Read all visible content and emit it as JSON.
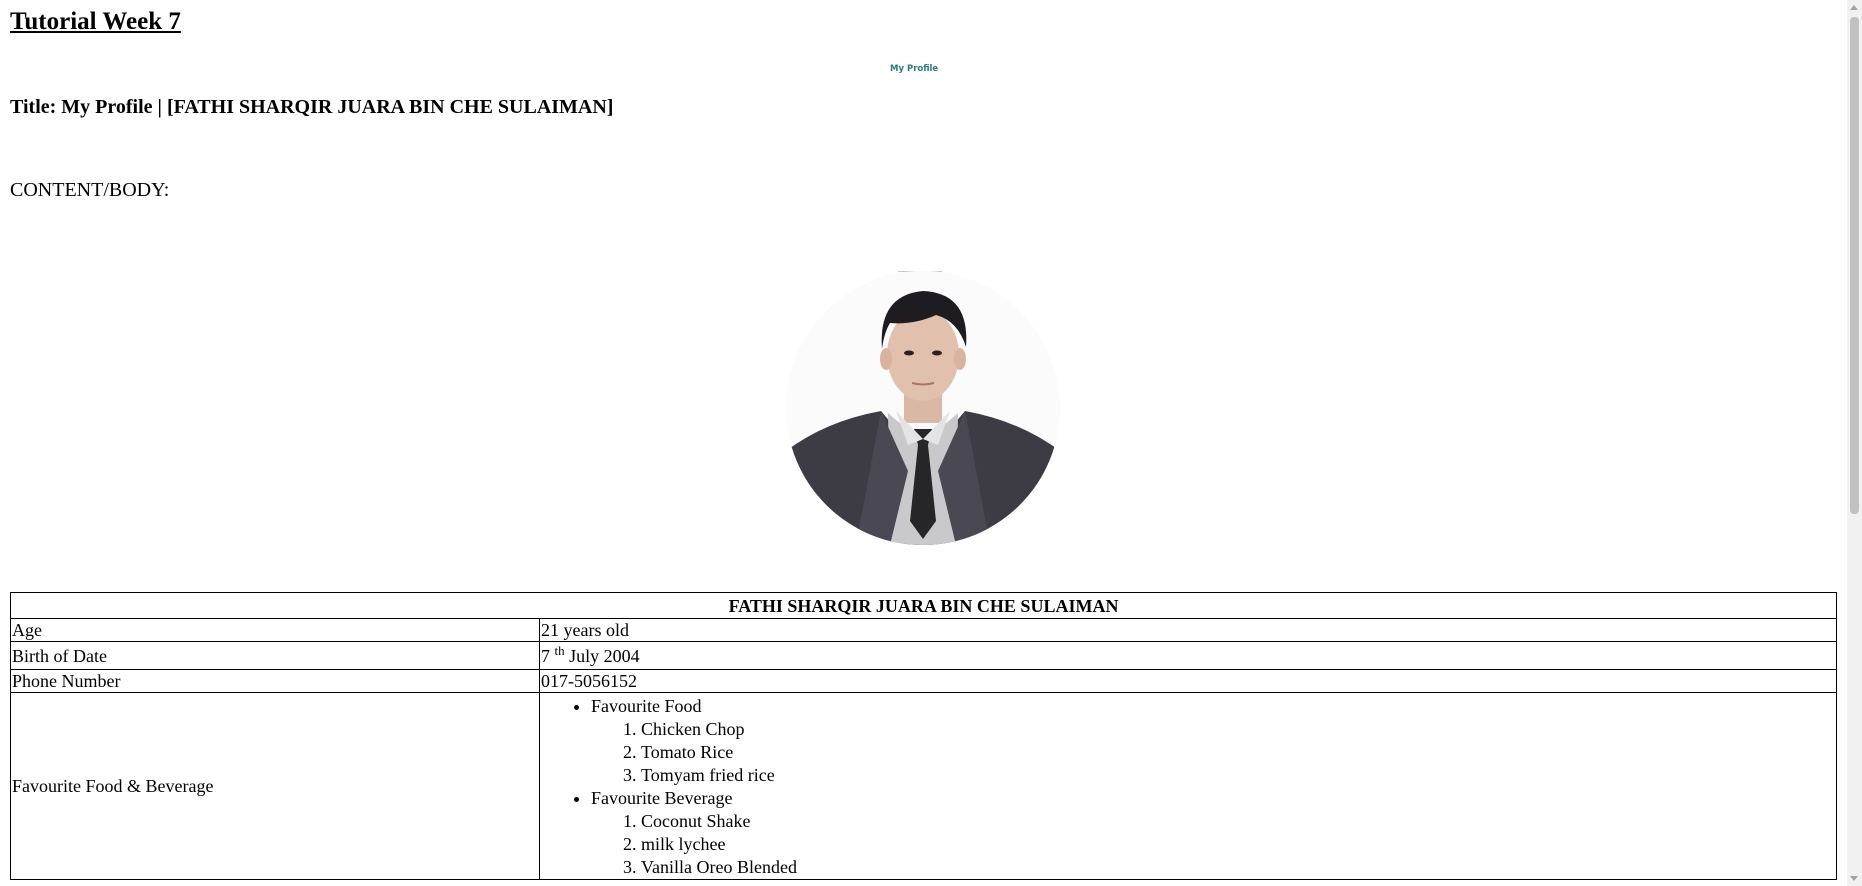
{
  "heading": "Tutorial Week 7",
  "title_line": "Title: My Profile | [FATHI SHARQIR JUARA BIN CHE SULAIMAN]",
  "body_label": "CONTENT/BODY:",
  "profile_caption": "My Profile",
  "table": {
    "header": "FATHI SHARQIR JUARA BIN CHE SULAIMAN",
    "rows": {
      "age": {
        "label": "Age",
        "value": "21 years old"
      },
      "birth": {
        "label": "Birth of Date",
        "day": "7",
        "suffix": "th",
        "rest": " July 2004"
      },
      "phone": {
        "label": "Phone Number",
        "value": "017-5056152"
      },
      "favourite": {
        "label": "Favourite Food & Beverage",
        "food_title": "Favourite Food",
        "foods": [
          "Chicken Chop",
          "Tomato Rice",
          "Tomyam fried rice"
        ],
        "beverage_title": "Favourite Beverage",
        "beverages": [
          "Coconut Shake",
          "milk lychee",
          "Vanilla Oreo Blended"
        ]
      }
    }
  }
}
